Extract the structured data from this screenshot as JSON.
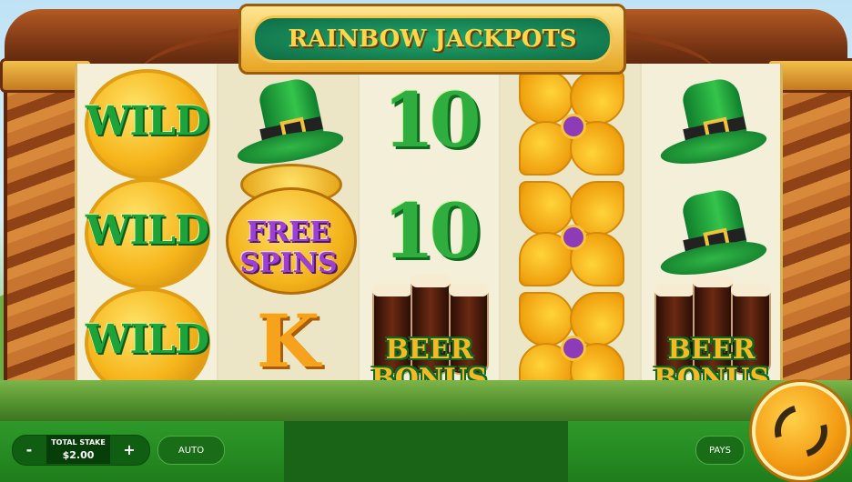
{
  "game": {
    "title": "RAINBOW JACKPOTS"
  },
  "reels": [
    [
      "WILD",
      "WILD",
      "WILD"
    ],
    [
      "hat",
      "FREE SPINS",
      "K"
    ],
    [
      "10",
      "10",
      "BEER BONUS"
    ],
    [
      "clover",
      "clover",
      "clover"
    ],
    [
      "hat",
      "hat",
      "BEER BONUS"
    ]
  ],
  "symbols": {
    "wild": "WILD",
    "ten": "10",
    "k": "K",
    "free_line1": "FREE",
    "free_line2": "SPINS",
    "beer_line1": "BEER",
    "beer_line2": "BONUS"
  },
  "controls": {
    "minus": "-",
    "plus": "+",
    "stake_label": "TOTAL STAKE",
    "stake_value": "$2.00",
    "auto": "AUTO",
    "pays": "PAYS"
  },
  "colors": {
    "accent_green": "#1f7d1b",
    "gold": "#f6b51b",
    "purple": "#9d3fcf"
  }
}
